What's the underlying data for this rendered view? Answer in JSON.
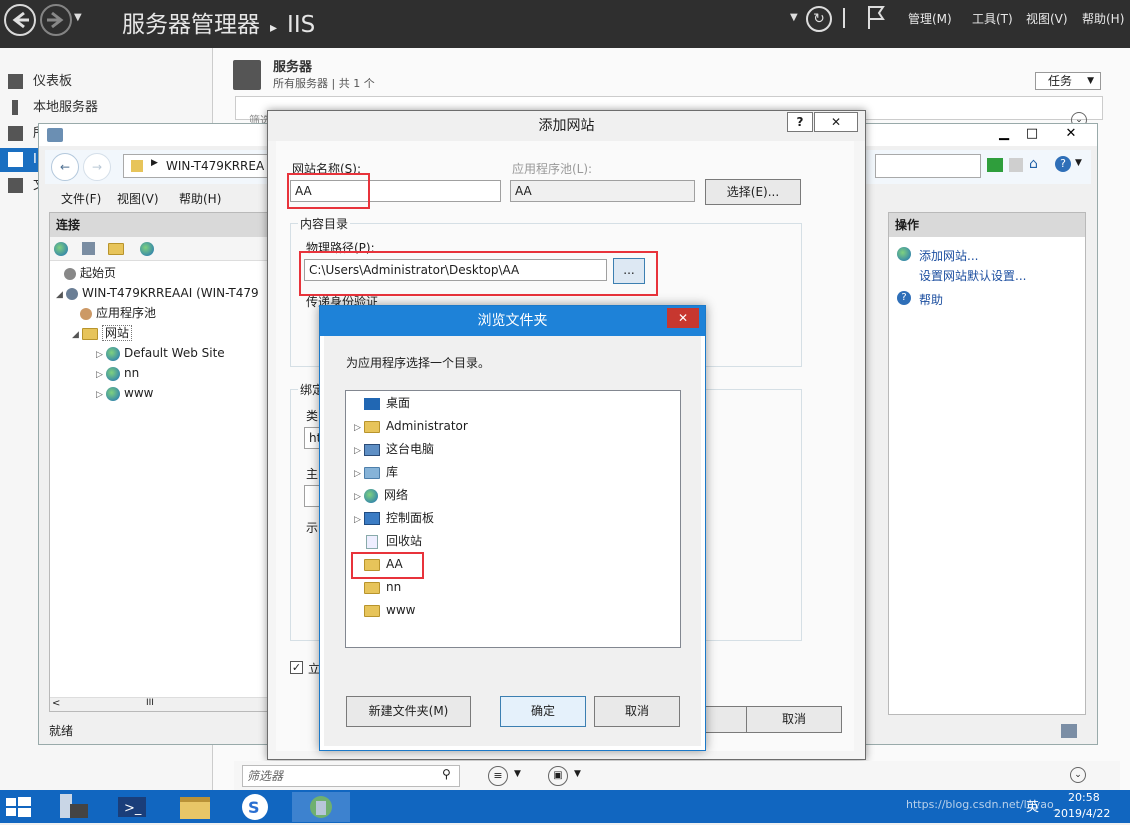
{
  "server_manager": {
    "title": "服务器管理器 ▸ IIS",
    "title_left": "服务器管理器",
    "title_sep": "▸",
    "title_right": "IIS",
    "menu": [
      "管理(M)",
      "工具(T)",
      "视图(V)",
      "帮助(H)"
    ],
    "side_items": [
      "仪表板",
      "本地服务器",
      "所",
      "I",
      "文"
    ],
    "servers_heading": "服务器",
    "servers_sub": "所有服务器 | 共 1 个",
    "tasks_button": "任务",
    "filter_placeholder": "筛选器",
    "filter_top": "筛选"
  },
  "iis": {
    "address": "WIN-T479KRREA",
    "menu": [
      "文件(F)",
      "视图(V)",
      "帮助(H)"
    ],
    "connections_title": "连接",
    "tree": [
      {
        "label": "起始页"
      },
      {
        "label": "WIN-T479KRREAAI (WIN-T479"
      },
      {
        "label": "应用程序池"
      },
      {
        "label": "网站"
      },
      {
        "label": "Default Web Site"
      },
      {
        "label": "nn"
      },
      {
        "label": "www"
      }
    ],
    "actions_title": "操作",
    "actions": [
      "添加网站...",
      "设置网站默认设置...",
      "帮助"
    ],
    "status": "就绪",
    "cancel_button": "取消"
  },
  "add_site_dialog": {
    "title": "添加网站",
    "help_btn": "?",
    "close_btn": "✕",
    "site_name_label": "网站名称(S):",
    "site_name_value": "AA",
    "app_pool_label": "应用程序池(L):",
    "app_pool_value": "AA",
    "select_button": "选择(E)...",
    "content_dir_label": "内容目录",
    "physical_path_label": "物理路径(P):",
    "physical_path_value": "C:\\Users\\Administrator\\Desktop\\AA",
    "browse_button": "...",
    "passthrough_label": "传递身份验证",
    "binding_label": "绑定",
    "type_label": "类",
    "ip_partial": "ht",
    "host_label": "主",
    "example_label": "示",
    "start_check_label": "立",
    "cancel_button": "取消"
  },
  "browse_dialog": {
    "title": "浏览文件夹",
    "close_btn": "✕",
    "prompt": "为应用程序选择一个目录。",
    "folders": [
      {
        "label": "桌面",
        "icon": "desktop-icon",
        "expand": false
      },
      {
        "label": "Administrator",
        "icon": "user-folder-icon",
        "expand": true
      },
      {
        "label": "这台电脑",
        "icon": "computer-icon",
        "expand": true
      },
      {
        "label": "库",
        "icon": "library-icon",
        "expand": true
      },
      {
        "label": "网络",
        "icon": "network-icon",
        "expand": true
      },
      {
        "label": "控制面板",
        "icon": "control-panel-icon",
        "expand": true
      },
      {
        "label": "回收站",
        "icon": "recycle-bin-icon",
        "expand": false
      },
      {
        "label": "AA",
        "icon": "folder-icon",
        "expand": false
      },
      {
        "label": "nn",
        "icon": "folder-icon",
        "expand": false
      },
      {
        "label": "www",
        "icon": "folder-icon",
        "expand": false
      }
    ],
    "new_folder_button": "新建文件夹(M)",
    "ok_button": "确定",
    "cancel_button": "取消"
  },
  "taskbar": {
    "clock_time": "20:58",
    "clock_date": "2019/4/22",
    "lang": "英",
    "watermark": "https://blog.csdn.net/luyao_"
  },
  "colors": {
    "highlight_red": "#e8333b",
    "title_blue": "#1e82d8",
    "taskbar_blue": "#1166c0"
  }
}
